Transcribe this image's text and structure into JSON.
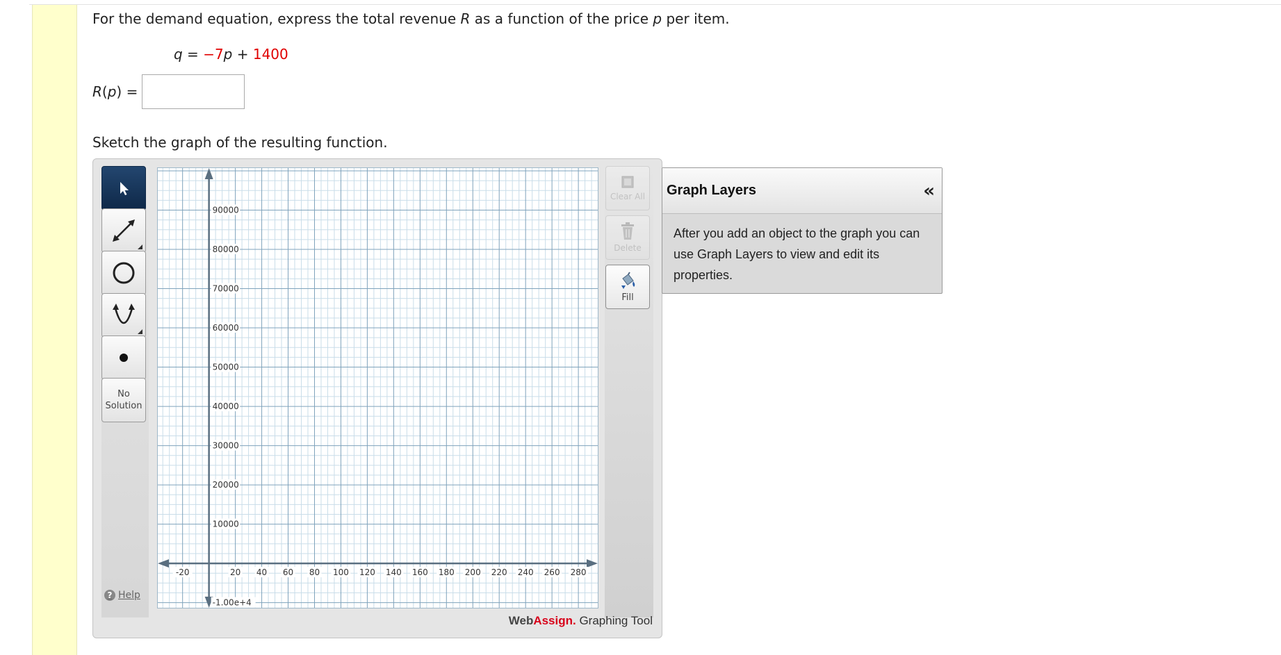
{
  "question": {
    "text_before_R": "For the demand equation, express the total revenue ",
    "var_R": "R",
    "text_middle": " as a function of the price ",
    "var_p": "p",
    "text_after": " per item."
  },
  "equation": {
    "lhs_var": "q",
    "equals": " = ",
    "coef": "−7",
    "var": "p",
    "plus": " + ",
    "constant": "1400"
  },
  "answer": {
    "label_var": "R",
    "label_rest_open": "(",
    "label_arg": "p",
    "label_rest_close": ") =",
    "value": ""
  },
  "sketch_prompt": "Sketch the graph of the resulting function.",
  "toolbar": {
    "pointer_icon": "pointer-arrow-icon",
    "line_icon": "line-segment-icon",
    "circle_icon": "circle-icon",
    "parabola_icon": "parabola-icon",
    "point_icon": "point-icon",
    "no_solution_line1": "No",
    "no_solution_line2": "Solution",
    "help_label": "Help"
  },
  "actions": {
    "clear_all_label": "Clear All",
    "delete_label": "Delete",
    "fill_label": "Fill"
  },
  "graph": {
    "x_ticks": [
      "-20",
      "20",
      "40",
      "60",
      "80",
      "100",
      "120",
      "140",
      "160",
      "180",
      "200",
      "220",
      "240",
      "260",
      "280"
    ],
    "y_ticks": [
      "90000",
      "80000",
      "70000",
      "60000",
      "50000",
      "40000",
      "30000",
      "20000",
      "10000",
      "-1.00e+4"
    ]
  },
  "brand": {
    "web": "Web",
    "assign": "Assign.",
    "tool": " Graphing Tool"
  },
  "layers": {
    "title": "Graph Layers",
    "collapse_icon": "«",
    "body": "After you add an object to the graph you can use Graph Layers to view and edit its properties."
  }
}
